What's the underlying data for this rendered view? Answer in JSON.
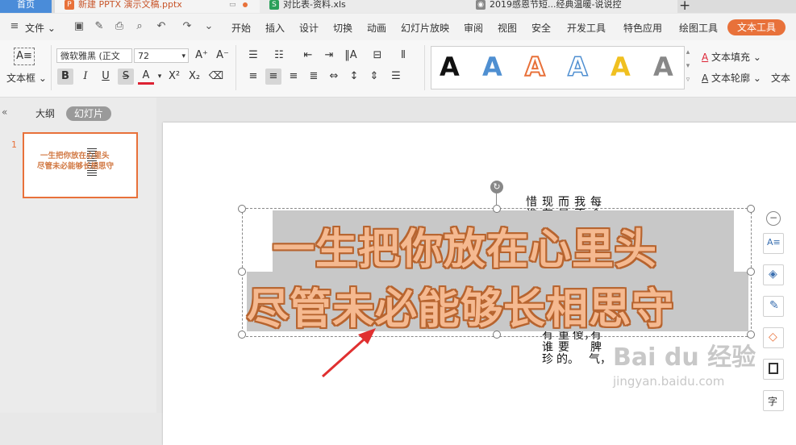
{
  "tabs": [
    {
      "label": "首页"
    },
    {
      "label": "新建 PPTX 演示文稿.pptx"
    },
    {
      "label": "对比表-资料.xls"
    },
    {
      "label": "2019感恩节短...经典温暖-说说控"
    }
  ],
  "menu": {
    "file": "文件",
    "items": [
      "开始",
      "插入",
      "设计",
      "切换",
      "动画",
      "幻灯片放映",
      "审阅",
      "视图",
      "安全",
      "开发工具",
      "特色应用",
      "绘图工具"
    ],
    "active": "文本工具"
  },
  "ribbon": {
    "textbox_label": "文本框",
    "font_name": "微软雅黑 (正文",
    "font_size": "72",
    "style_glyph": "A",
    "text_fill": "文本填充",
    "text_outline": "文本轮廓",
    "text_effect_cut": "文本"
  },
  "panel": {
    "outline_tab": "大纲",
    "slides_tab": "幻灯片",
    "slide_number": "1",
    "thumb_line1": "一生把你放在心里头",
    "thumb_line2": "尽管未必能够长相思守"
  },
  "slide": {
    "line1": "一生把你放在心里头",
    "line2": "尽管未必能够长相思守",
    "vertical_columns": [
      "每个人都有自己的底线，都有脾气，",
      "我不说，不计较，不代表我真傻，",
      "而是当我觉得你值得，是最重要的。",
      "现在不会没有人珍惜谁，只有谁珍",
      "惜谁"
    ]
  },
  "watermark": {
    "brand": "Bai du 经验",
    "url": "jingyan.baidu.com"
  },
  "colors": {
    "accent": "#e8713a",
    "art_fill": "#f5b990",
    "art_outline": "#b7642f"
  }
}
